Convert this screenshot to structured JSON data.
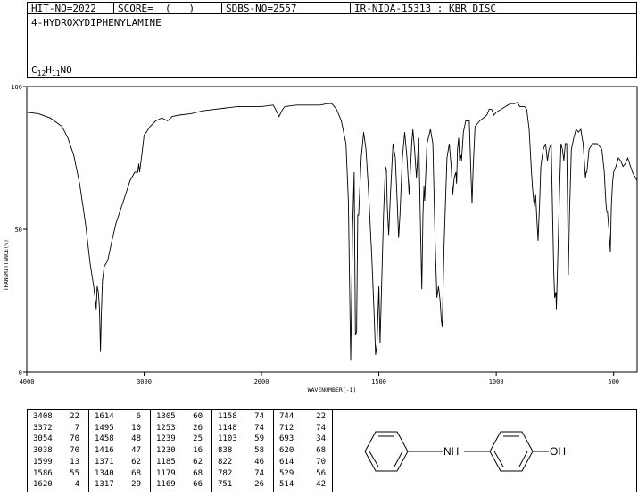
{
  "header": {
    "hit_no": "HIT-NO=2022",
    "score": "SCORE=  (   )",
    "sdbs_no": "SDBS-NO=2557",
    "method": "IR-NIDA-15313 : KBR DISC"
  },
  "compound": {
    "name": "4-HYDROXYDIPHENYLAMINE",
    "formula_parts": [
      "C",
      "12",
      "H",
      "11",
      "NO"
    ]
  },
  "chart_data": {
    "type": "line",
    "xlabel": "WAVENUMBER(-1)",
    "ylabel": "TRANSMITTANCE(%)",
    "xlim": [
      4000,
      400
    ],
    "ylim": [
      0,
      100
    ],
    "x_ticks": [
      4000,
      3000,
      2000,
      1500,
      1000,
      500
    ],
    "y_ticks": [
      0,
      50,
      100
    ],
    "x_reversed": true,
    "grid": false,
    "series": [
      {
        "points": [
          [
            4000,
            91
          ],
          [
            3900,
            90.5
          ],
          [
            3800,
            89
          ],
          [
            3700,
            86
          ],
          [
            3650,
            82
          ],
          [
            3600,
            76
          ],
          [
            3550,
            66
          ],
          [
            3500,
            52
          ],
          [
            3460,
            38
          ],
          [
            3430,
            30
          ],
          [
            3410,
            23
          ],
          [
            3408,
            22
          ],
          [
            3400,
            30
          ],
          [
            3390,
            28
          ],
          [
            3380,
            22
          ],
          [
            3372,
            7
          ],
          [
            3365,
            20
          ],
          [
            3355,
            32
          ],
          [
            3340,
            37
          ],
          [
            3310,
            39
          ],
          [
            3280,
            45
          ],
          [
            3240,
            52
          ],
          [
            3200,
            57
          ],
          [
            3160,
            62
          ],
          [
            3120,
            67
          ],
          [
            3080,
            70
          ],
          [
            3054,
            70
          ],
          [
            3046,
            73
          ],
          [
            3038,
            70
          ],
          [
            3020,
            76
          ],
          [
            3000,
            83
          ],
          [
            2980,
            84
          ],
          [
            2950,
            86
          ],
          [
            2900,
            88
          ],
          [
            2850,
            89
          ],
          [
            2800,
            88
          ],
          [
            2760,
            89.5
          ],
          [
            2700,
            90
          ],
          [
            2600,
            90.5
          ],
          [
            2500,
            91.5
          ],
          [
            2400,
            92
          ],
          [
            2300,
            92.5
          ],
          [
            2200,
            93
          ],
          [
            2100,
            93
          ],
          [
            2000,
            93
          ],
          [
            1950,
            93.5
          ],
          [
            1940,
            92
          ],
          [
            1925,
            89.5
          ],
          [
            1910,
            92
          ],
          [
            1900,
            93
          ],
          [
            1850,
            93.5
          ],
          [
            1800,
            93.5
          ],
          [
            1750,
            93.5
          ],
          [
            1720,
            94
          ],
          [
            1700,
            94
          ],
          [
            1680,
            92
          ],
          [
            1660,
            88
          ],
          [
            1640,
            80
          ],
          [
            1630,
            60
          ],
          [
            1620,
            4
          ],
          [
            1612,
            50
          ],
          [
            1605,
            70
          ],
          [
            1600,
            13
          ],
          [
            1595,
            14
          ],
          [
            1590,
            55
          ],
          [
            1586,
            55
          ],
          [
            1575,
            75
          ],
          [
            1565,
            84
          ],
          [
            1555,
            78
          ],
          [
            1545,
            65
          ],
          [
            1530,
            40
          ],
          [
            1520,
            20
          ],
          [
            1514,
            6
          ],
          [
            1508,
            10
          ],
          [
            1500,
            30
          ],
          [
            1495,
            10
          ],
          [
            1490,
            25
          ],
          [
            1480,
            55
          ],
          [
            1472,
            72
          ],
          [
            1468,
            71
          ],
          [
            1464,
            58
          ],
          [
            1458,
            48
          ],
          [
            1452,
            60
          ],
          [
            1440,
            80
          ],
          [
            1430,
            75
          ],
          [
            1422,
            60
          ],
          [
            1416,
            47
          ],
          [
            1410,
            55
          ],
          [
            1400,
            75
          ],
          [
            1390,
            84
          ],
          [
            1380,
            75
          ],
          [
            1371,
            62
          ],
          [
            1360,
            80
          ],
          [
            1355,
            85
          ],
          [
            1348,
            78
          ],
          [
            1340,
            68
          ],
          [
            1330,
            82
          ],
          [
            1322,
            48
          ],
          [
            1317,
            29
          ],
          [
            1312,
            55
          ],
          [
            1308,
            65
          ],
          [
            1305,
            60
          ],
          [
            1295,
            80
          ],
          [
            1280,
            85
          ],
          [
            1270,
            80
          ],
          [
            1260,
            45
          ],
          [
            1253,
            26
          ],
          [
            1246,
            30
          ],
          [
            1239,
            25
          ],
          [
            1234,
            18
          ],
          [
            1230,
            16
          ],
          [
            1222,
            45
          ],
          [
            1210,
            75
          ],
          [
            1200,
            80
          ],
          [
            1192,
            72
          ],
          [
            1185,
            62
          ],
          [
            1179,
            68
          ],
          [
            1172,
            70
          ],
          [
            1169,
            66
          ],
          [
            1165,
            78
          ],
          [
            1160,
            82
          ],
          [
            1156,
            74
          ],
          [
            1150,
            76
          ],
          [
            1148,
            74
          ],
          [
            1140,
            84
          ],
          [
            1130,
            88
          ],
          [
            1115,
            88
          ],
          [
            1108,
            70
          ],
          [
            1103,
            59
          ],
          [
            1098,
            72
          ],
          [
            1090,
            86
          ],
          [
            1070,
            88
          ],
          [
            1040,
            90
          ],
          [
            1030,
            92
          ],
          [
            1020,
            92
          ],
          [
            1010,
            90
          ],
          [
            1000,
            91
          ],
          [
            980,
            92
          ],
          [
            960,
            93
          ],
          [
            940,
            94
          ],
          [
            920,
            94
          ],
          [
            910,
            94.5
          ],
          [
            900,
            93
          ],
          [
            880,
            93
          ],
          [
            870,
            92
          ],
          [
            860,
            85
          ],
          [
            850,
            70
          ],
          [
            845,
            64
          ],
          [
            838,
            58
          ],
          [
            832,
            62
          ],
          [
            828,
            55
          ],
          [
            822,
            46
          ],
          [
            815,
            60
          ],
          [
            810,
            72
          ],
          [
            800,
            78
          ],
          [
            790,
            80
          ],
          [
            782,
            74
          ],
          [
            775,
            78
          ],
          [
            766,
            80
          ],
          [
            760,
            55
          ],
          [
            755,
            35
          ],
          [
            751,
            26
          ],
          [
            746,
            28
          ],
          [
            744,
            22
          ],
          [
            738,
            40
          ],
          [
            730,
            65
          ],
          [
            724,
            80
          ],
          [
            718,
            78
          ],
          [
            712,
            74
          ],
          [
            706,
            80
          ],
          [
            700,
            80
          ],
          [
            695,
            50
          ],
          [
            693,
            34
          ],
          [
            688,
            55
          ],
          [
            680,
            78
          ],
          [
            670,
            82
          ],
          [
            660,
            85
          ],
          [
            650,
            84
          ],
          [
            640,
            85
          ],
          [
            630,
            80
          ],
          [
            625,
            74
          ],
          [
            620,
            68
          ],
          [
            617,
            70
          ],
          [
            614,
            70
          ],
          [
            605,
            78
          ],
          [
            590,
            80
          ],
          [
            570,
            80
          ],
          [
            550,
            78
          ],
          [
            540,
            70
          ],
          [
            535,
            62
          ],
          [
            532,
            58
          ],
          [
            529,
            56
          ],
          [
            526,
            56
          ],
          [
            520,
            50
          ],
          [
            514,
            42
          ],
          [
            510,
            58
          ],
          [
            505,
            66
          ],
          [
            500,
            70
          ],
          [
            490,
            72
          ],
          [
            480,
            75
          ],
          [
            470,
            74
          ],
          [
            460,
            72
          ],
          [
            450,
            73
          ],
          [
            440,
            75
          ],
          [
            420,
            70
          ],
          [
            400,
            67
          ]
        ]
      }
    ]
  },
  "peak_table": [
    [
      [
        "3408",
        "22"
      ],
      [
        "3372",
        "7"
      ],
      [
        "3054",
        "70"
      ],
      [
        "3038",
        "70"
      ],
      [
        "1599",
        "13"
      ],
      [
        "1586",
        "55"
      ],
      [
        "1620",
        "4"
      ]
    ],
    [
      [
        "1614",
        "6"
      ],
      [
        "1495",
        "10"
      ],
      [
        "1458",
        "48"
      ],
      [
        "1416",
        "47"
      ],
      [
        "1371",
        "62"
      ],
      [
        "1340",
        "68"
      ],
      [
        "1317",
        "29"
      ]
    ],
    [
      [
        "1305",
        "60"
      ],
      [
        "1253",
        "26"
      ],
      [
        "1239",
        "25"
      ],
      [
        "1230",
        "16"
      ],
      [
        "1185",
        "62"
      ],
      [
        "1179",
        "68"
      ],
      [
        "1169",
        "66"
      ]
    ],
    [
      [
        "1158",
        "74"
      ],
      [
        "1148",
        "74"
      ],
      [
        "1103",
        "59"
      ],
      [
        "838",
        "58"
      ],
      [
        "822",
        "46"
      ],
      [
        "782",
        "74"
      ],
      [
        "751",
        "26"
      ]
    ],
    [
      [
        "744",
        "22"
      ],
      [
        "712",
        "74"
      ],
      [
        "693",
        "34"
      ],
      [
        "620",
        "68"
      ],
      [
        "614",
        "70"
      ],
      [
        "529",
        "56"
      ],
      [
        "514",
        "42"
      ]
    ]
  ],
  "structure": {
    "nh_label": "NH",
    "oh_label": "OH"
  }
}
